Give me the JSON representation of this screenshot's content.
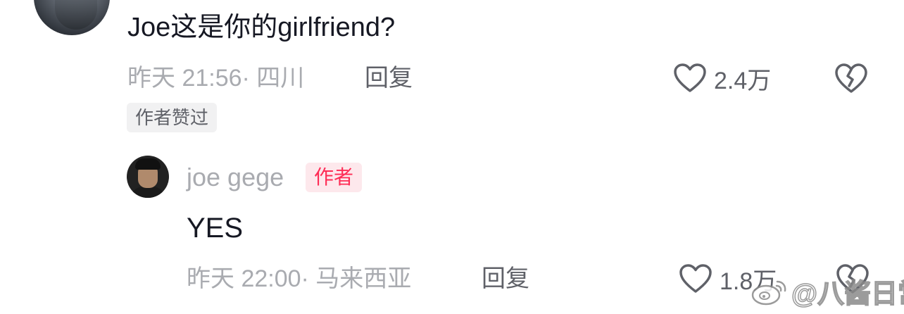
{
  "comment": {
    "text": "Joe这是你的girlfriend?",
    "meta": "昨天 21:56· 四川",
    "reply_label": "回复",
    "like_count": "2.4万",
    "author_liked_badge": "作者赞过"
  },
  "reply": {
    "username": "joe gege",
    "author_tag": "作者",
    "text": "YES",
    "meta": "昨天 22:00· 马来西亚",
    "reply_label": "回复",
    "like_count": "1.8万"
  },
  "watermark": {
    "text": "@八酱日常"
  },
  "icons": {
    "like": "heart-outline-icon",
    "dislike": "broken-heart-icon",
    "watermark_logo": "weibo-logo-icon"
  },
  "colors": {
    "primary_text": "#161823",
    "secondary_text": "#a9abb0",
    "action_text": "#5f6168",
    "author_tag_text": "#fe2c55",
    "author_tag_bg": "#fde8ec",
    "badge_bg": "#f1f1f2"
  }
}
